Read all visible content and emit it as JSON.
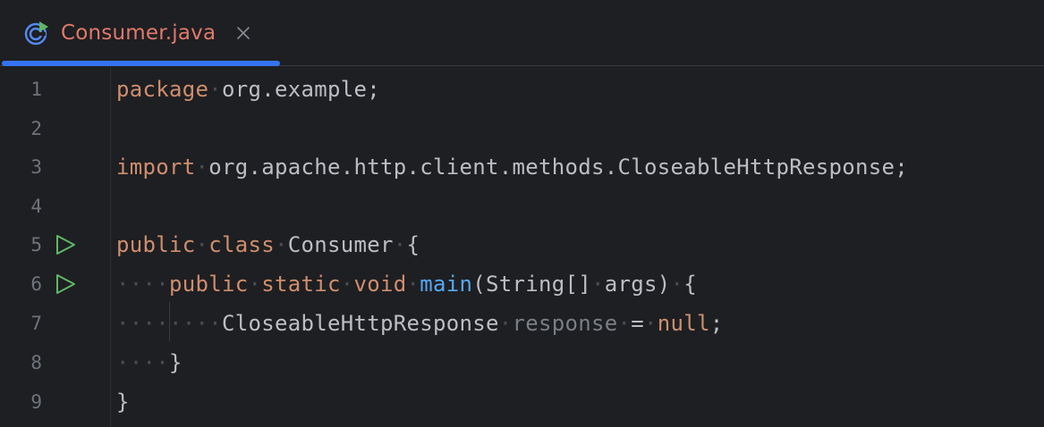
{
  "tab": {
    "filename": "Consumer.java",
    "icon": "java-class-icon",
    "active": true
  },
  "colors": {
    "background": "#1e1f22",
    "keyword": "#cf8e6d",
    "function": "#56a8f5",
    "text": "#bcbec4",
    "unused_variable": "#7a7e85",
    "line_number": "#6f737a",
    "tab_accent": "#3574f0",
    "tab_label": "#e0796c",
    "run_icon": "#5fb865"
  },
  "editor": {
    "line_numbers": [
      "1",
      "2",
      "3",
      "4",
      "5",
      "6",
      "7",
      "8",
      "9"
    ],
    "lines": [
      {
        "kw1": "package",
        "text": "org.example;"
      },
      {},
      {
        "kw1": "import",
        "text": "org.apache.http.client.methods.CloseableHttpResponse;"
      },
      {},
      {
        "kw1": "public",
        "kw2": "class",
        "name": "Consumer",
        "brace": "{"
      },
      {
        "kw1": "public",
        "kw2": "static",
        "kw3": "void",
        "method": "main",
        "params": "(String[]",
        "arg": "args)",
        "brace": "{"
      },
      {
        "type": "CloseableHttpResponse",
        "var": "response",
        "op": "=",
        "kw": "null",
        "end": ";"
      },
      {
        "brace": "}"
      },
      {
        "brace": "}"
      }
    ]
  },
  "gutter": {
    "run_lines": [
      "5",
      "6"
    ],
    "run_icon": "run-play-icon"
  }
}
